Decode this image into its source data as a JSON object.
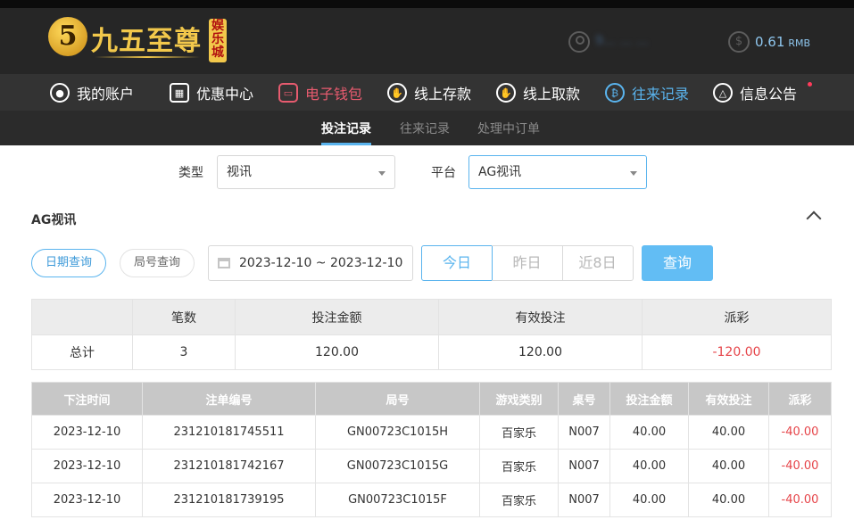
{
  "header": {
    "logo_number": "5",
    "logo_text": "九五至尊",
    "logo_badge": "娱乐城",
    "username": "9…  … …",
    "balance": "0.61",
    "currency": "RMB"
  },
  "nav": {
    "items": [
      {
        "label": "我的账户",
        "icon": "user-icon"
      },
      {
        "label": "优惠中心",
        "icon": "gift-icon"
      },
      {
        "label": "电子钱包",
        "icon": "wallet-icon"
      },
      {
        "label": "线上存款",
        "icon": "deposit-icon"
      },
      {
        "label": "线上取款",
        "icon": "withdraw-icon"
      },
      {
        "label": "往来记录",
        "icon": "record-icon"
      },
      {
        "label": "信息公告",
        "icon": "bell-icon"
      }
    ]
  },
  "subnav": {
    "tabs": [
      {
        "label": "投注记录"
      },
      {
        "label": "往来记录"
      },
      {
        "label": "处理中订单"
      }
    ]
  },
  "filters": {
    "type_label": "类型",
    "type_value": "视讯",
    "platform_label": "平台",
    "platform_value": "AG视讯"
  },
  "section": {
    "title": "AG视讯"
  },
  "query": {
    "date_query": "日期查询",
    "round_query": "局号查询",
    "date_range": "2023-12-10 ~ 2023-12-10",
    "today": "今日",
    "yesterday": "昨日",
    "last8": "近8日",
    "submit": "查询"
  },
  "summary": {
    "headers": [
      "",
      "笔数",
      "投注金额",
      "有效投注",
      "派彩"
    ],
    "row": [
      "总计",
      "3",
      "120.00",
      "120.00",
      "-120.00"
    ]
  },
  "detail": {
    "headers": [
      "下注时间",
      "注单编号",
      "局号",
      "游戏类别",
      "桌号",
      "投注金额",
      "有效投注",
      "派彩"
    ],
    "rows": [
      [
        "2023-12-10",
        "231210181745511",
        "GN00723C1015H",
        "百家乐",
        "N007",
        "40.00",
        "40.00",
        "-40.00"
      ],
      [
        "2023-12-10",
        "231210181742167",
        "GN00723C1015G",
        "百家乐",
        "N007",
        "40.00",
        "40.00",
        "-40.00"
      ],
      [
        "2023-12-10",
        "231210181739195",
        "GN00723C1015F",
        "百家乐",
        "N007",
        "40.00",
        "40.00",
        "-40.00"
      ]
    ]
  },
  "colors": {
    "accent": "#5ab4ee",
    "negative": "#e6454a",
    "wallet_active": "#e75b6f"
  }
}
